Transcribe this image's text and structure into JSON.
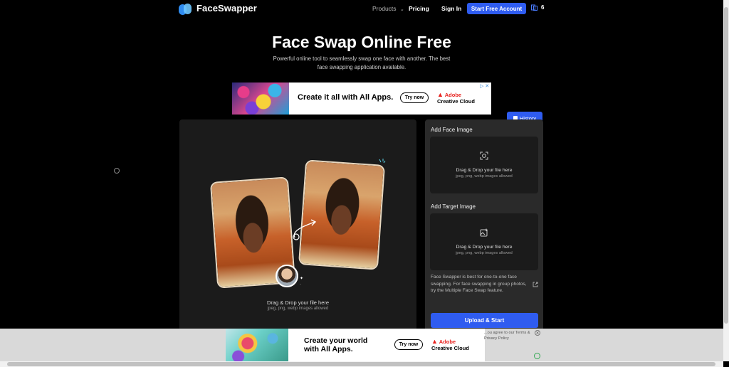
{
  "nav": {
    "brand": "FaceSwapper",
    "products": "Products",
    "pricing": "Pricing",
    "sign_in": "Sign In",
    "cta": "Start Free Account",
    "credits": "6"
  },
  "hero": {
    "title": "Face Swap Online Free",
    "subtitle": "Powerful online tool to seamlessly swap one face with another. The best face swapping application available."
  },
  "ad_top": {
    "headline": "Create it all with All Apps.",
    "button": "Try now",
    "brand_line1": "Adobe",
    "brand_line2": "Creative Cloud"
  },
  "history": {
    "label": "History"
  },
  "preview": {
    "drop_title": "Drag & Drop your file here",
    "drop_sub": "jpeg, png, webp images allowed"
  },
  "panel": {
    "face_label": "Add Face Image",
    "face_drop_title": "Drag & Drop your file here",
    "face_drop_sub": "jpeg, png, webp images allowed",
    "target_label": "Add Target Image",
    "target_drop_title": "Drag & Drop your file here",
    "target_drop_sub": "jpeg, png, webp images allowed",
    "info": "Face Swapper is best for one-to-one face swapping. For face swapping in group photos, try the Multiple Face Swap feature.",
    "upload": "Upload & Start"
  },
  "ad_bottom": {
    "headline_line1": "Create your world",
    "headline_line2": "with All Apps.",
    "button": "Try now",
    "brand_line1": "Adobe",
    "brand_line2": "Creative Cloud"
  },
  "terms": {
    "text": "...ou agree to our Terms & Privacy Policy"
  },
  "colors": {
    "accent": "#2f5cf0",
    "panel": "#2a2a2a",
    "background": "#000000"
  }
}
